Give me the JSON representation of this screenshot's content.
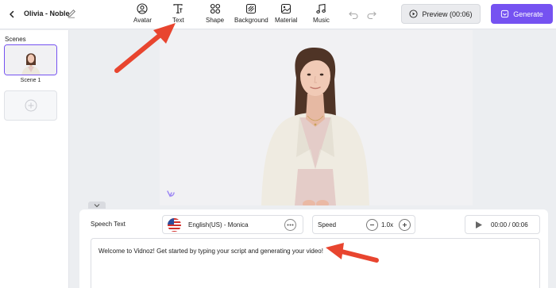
{
  "header": {
    "project_name": "Olivia - Noble",
    "tools": [
      {
        "label": "Avatar",
        "icon": "avatar-icon"
      },
      {
        "label": "Text",
        "icon": "text-icon"
      },
      {
        "label": "Shape",
        "icon": "shape-icon"
      },
      {
        "label": "Background",
        "icon": "background-icon"
      },
      {
        "label": "Material",
        "icon": "material-icon"
      },
      {
        "label": "Music",
        "icon": "music-icon"
      }
    ],
    "preview_label": "Preview (00:06)",
    "generate_label": "Generate"
  },
  "scenes": {
    "title": "Scenes",
    "items": [
      {
        "label": "Scene 1"
      }
    ]
  },
  "editor": {
    "speech_text_label": "Speech Text",
    "voice": "English(US) - Monica",
    "speed_label": "Speed",
    "speed_value": "1.0x",
    "time": "00:00 / 00:06",
    "script_text": "Welcome to Vidnoz! Get started by typing your script and generating your video!"
  },
  "colors": {
    "accent": "#7552f1",
    "annotation_arrow": "#e8452f"
  }
}
